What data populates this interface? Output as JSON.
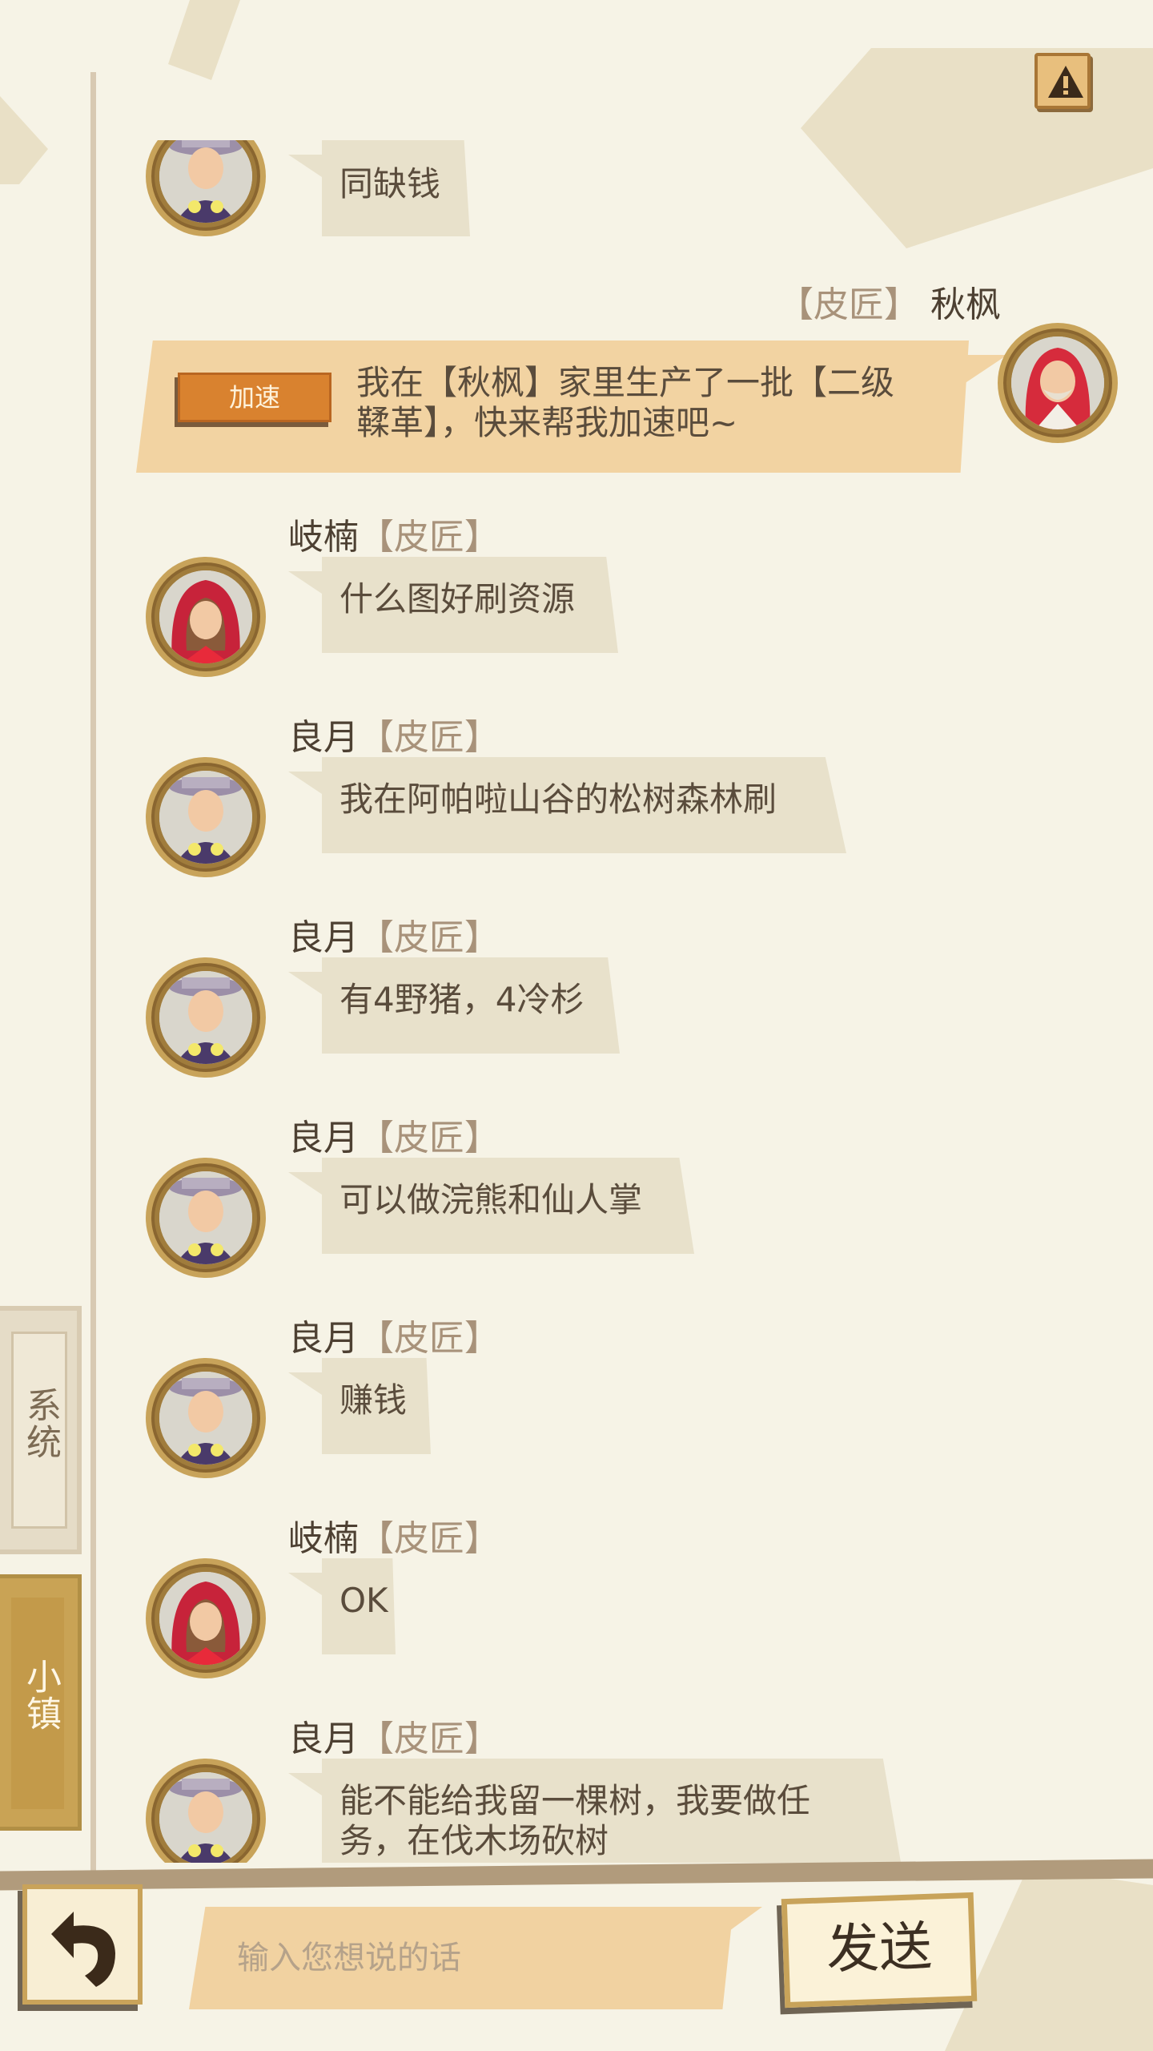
{
  "warning_icon": "warning-triangle-icon",
  "side_tabs": {
    "system": "系统",
    "town": "小镇"
  },
  "self_message": {
    "job": "【皮匠】",
    "name": "秋枫",
    "accelerate_label": "加速",
    "text": "我在【秋枫】家里生产了一批【二级鞣革】，快来帮我加速吧~"
  },
  "messages": [
    {
      "name": "",
      "job": "",
      "text": "同缺钱",
      "avatar": "hat-woman"
    },
    {
      "name": "岐楠",
      "job": "【皮匠】",
      "text": "什么图好刷资源",
      "avatar": "red-hood"
    },
    {
      "name": "良月",
      "job": "【皮匠】",
      "text": "我在阿帕啦山谷的松树森林刷",
      "avatar": "hat-woman"
    },
    {
      "name": "良月",
      "job": "【皮匠】",
      "text": "有4野猪，4冷杉",
      "avatar": "hat-woman"
    },
    {
      "name": "良月",
      "job": "【皮匠】",
      "text": "可以做浣熊和仙人掌",
      "avatar": "hat-woman"
    },
    {
      "name": "良月",
      "job": "【皮匠】",
      "text": "赚钱",
      "avatar": "hat-woman"
    },
    {
      "name": "岐楠",
      "job": "【皮匠】",
      "text": "OK",
      "avatar": "red-hood"
    },
    {
      "name": "良月",
      "job": "【皮匠】",
      "text_line1": "能不能给我留一棵树，我要做任",
      "text_line2": "务，在伐木场砍树",
      "avatar": "hat-woman"
    }
  ],
  "input": {
    "placeholder": "输入您想说的话"
  },
  "send_label": "发送",
  "back_icon": "return-arrow-icon"
}
